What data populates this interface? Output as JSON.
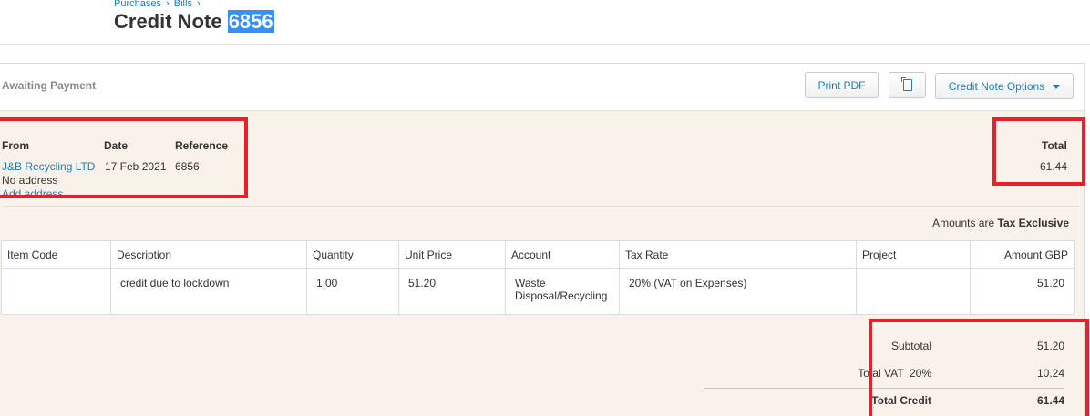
{
  "breadcrumb": {
    "purchases": "Purchases",
    "bills": "Bills",
    "sep": "›"
  },
  "page": {
    "title_prefix": "Credit Note",
    "title_number": "6856"
  },
  "toolbar": {
    "status": "Awaiting Payment",
    "print_label": "Print PDF",
    "options_label": "Credit Note Options"
  },
  "info": {
    "from_label": "From",
    "date_label": "Date",
    "reference_label": "Reference",
    "total_label": "Total",
    "from_name": "J&B Recycling LTD",
    "from_address": "No address",
    "add_address": "Add address",
    "date": "17 Feb 2021",
    "reference": "6856",
    "total": "61.44"
  },
  "amounts_note": {
    "prefix": "Amounts are",
    "mode": "Tax Exclusive"
  },
  "table": {
    "headers": [
      "Item Code",
      "Description",
      "Quantity",
      "Unit Price",
      "Account",
      "Tax Rate",
      "Project",
      "Amount GBP"
    ],
    "rows": [
      {
        "item_code": "",
        "description": "credit due to lockdown",
        "quantity": "1.00",
        "unit_price": "51.20",
        "account": "Waste Disposal/Recycling",
        "tax_rate": "20% (VAT on Expenses)",
        "project": "",
        "amount": "51.20"
      }
    ]
  },
  "totals": {
    "subtotal_label": "Subtotal",
    "subtotal": "51.20",
    "vat_label": "Total VAT  20%",
    "vat": "10.24",
    "credit_label": "Total Credit",
    "credit": "61.44"
  },
  "colors": {
    "link": "#1a7fb5",
    "panel_bg": "#f8f2ea",
    "annotation": "#e8202a",
    "highlight": "#3390ff"
  }
}
